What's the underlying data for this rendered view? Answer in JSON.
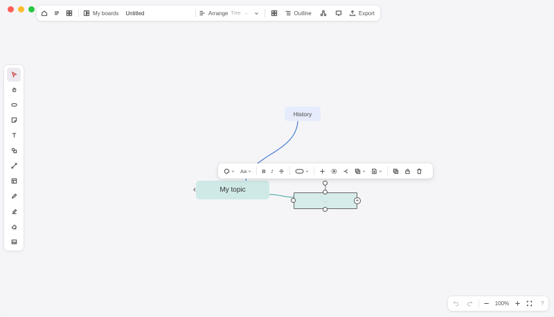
{
  "window": {
    "traffic_lights": [
      "close",
      "minimize",
      "maximize"
    ]
  },
  "topbar": {
    "home_icon": "home-icon",
    "menu_icon": "menu-icon",
    "grid_icon": "grid-icon",
    "boards_label": "My boards",
    "doc_title": "Untitled",
    "arrange_label": "Arrange",
    "arrange_value": "Tree",
    "outline_label": "Outline",
    "export_label": "Export"
  },
  "canvas": {
    "nodes": {
      "history": "History",
      "topic": "My topic",
      "new_placeholder": "..."
    }
  },
  "format_toolbar": {
    "font_label": "Aa",
    "bold_label": "B",
    "italic_label": "I"
  },
  "zoombar": {
    "zoom_label": "100%",
    "help_label": "?"
  },
  "colors": {
    "accent_blue": "#e6ecfb",
    "topic_teal": "#cfe9e7",
    "edge_blue": "#4a7bd0",
    "edge_teal": "#5fb0aa"
  }
}
